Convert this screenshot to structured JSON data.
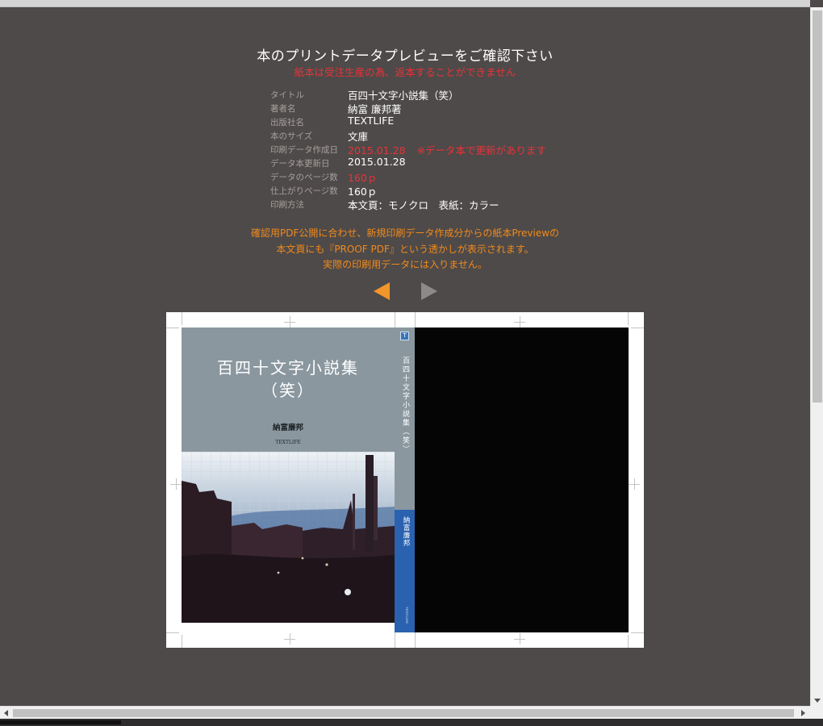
{
  "page": {
    "title": "本のプリントデータプレビューをご確認下さい",
    "warning": "紙本は受注生産の為、返本することができません"
  },
  "book_info": [
    {
      "label": "タイトル",
      "value": "百四十文字小説集（笑）",
      "highlight": false
    },
    {
      "label": "著者名",
      "value": "納富 廉邦著",
      "highlight": false
    },
    {
      "label": "出版社名",
      "value": "TEXTLIFE",
      "highlight": false
    },
    {
      "label": "本のサイズ",
      "value": "文庫",
      "highlight": false
    },
    {
      "label": "印刷データ作成日",
      "value": "2015.01.28",
      "note": "※データ本で更新があります",
      "highlight": true
    },
    {
      "label": "データ本更新日",
      "value": "2015.01.28",
      "highlight": false
    },
    {
      "label": "データのページ数",
      "value": "160ｐ",
      "highlight": true
    },
    {
      "label": "仕上がりページ数",
      "value": "160ｐ",
      "highlight": false
    },
    {
      "label": "印刷方法",
      "value": "本文頁：モノクロ　表紙：カラー",
      "highlight": false
    }
  ],
  "notice": {
    "line1": "確認用PDF公開に合わせ、新規印刷データ作成分からの紙本Previewの",
    "line2": "本文頁にも『PROOF PDF』という透かしが表示されます。",
    "line3": "実際の印刷用データには入りません。"
  },
  "preview": {
    "cover_title_line1": "百四十文字小説集",
    "cover_title_line2": "（笑）",
    "cover_author": "納富廉邦",
    "cover_publisher": "TEXTLIFE",
    "spine_title": "百四十文字小説集（笑）",
    "spine_author": "納富廉邦",
    "spine_publisher": "TEXTLIFE"
  },
  "colors": {
    "background": "#4e4a49",
    "warning_red": "#e8323a",
    "notice_orange": "#f28a1c",
    "prev_arrow": "#f2952a",
    "next_arrow": "#8c8a89",
    "cover_gray_blue": "#8a979f",
    "spine_blue": "#2a62b0"
  },
  "icons": {
    "prev": "triangle-left-icon",
    "next": "triangle-right-icon"
  }
}
